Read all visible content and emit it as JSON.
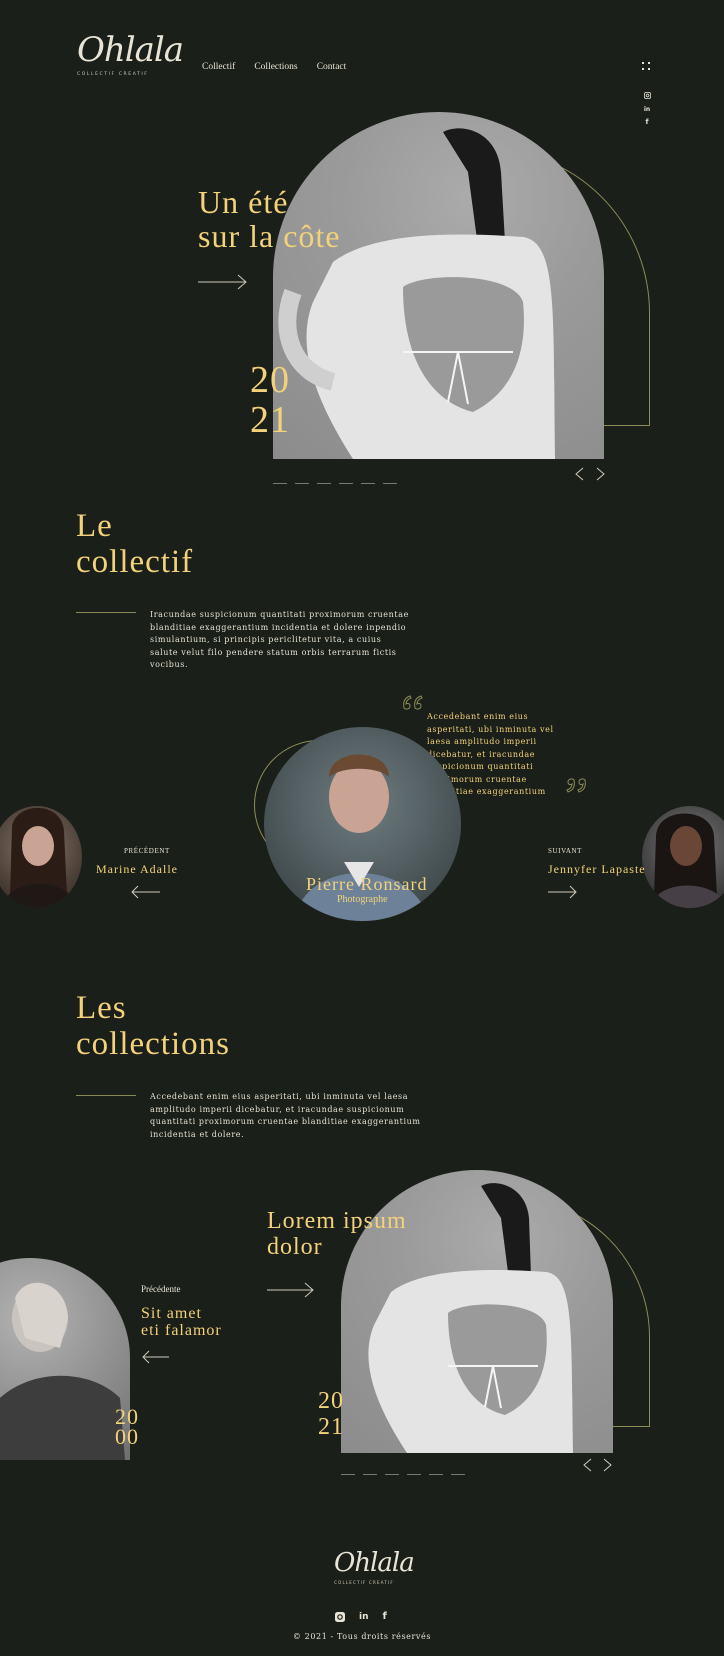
{
  "brand": {
    "logo": "Ohlala",
    "tagline": "COLLECTIF CREATIF"
  },
  "nav": {
    "items": [
      "Collectif",
      "Collections",
      "Contact"
    ]
  },
  "hero": {
    "title_line1": "Un été",
    "title_line2": "sur la côte",
    "year_top": "20",
    "year_bottom": "21"
  },
  "collectif": {
    "title_line1": "Le",
    "title_line2": "collectif",
    "text": "Iracundae suspicionum quantitati proximorum cruentae blanditiae exaggerantium incidentia et dolere inpendio simulantium, si principis periclitetur vita, a cuius salute velut filo pendere statum orbis terrarum fictis vocibus."
  },
  "member": {
    "quote": "Accedebant enim eius asperitati, ubi inminuta vel laesa amplitudo imperii dicebatur, et iracundae suspicionum quantitati proximorum cruentae blanditiae exaggerantium filo.",
    "name": "Pierre Ronsard",
    "role": "Photographe",
    "prev_label": "PRÉCÉDENT",
    "prev_name": "Marine Adalle",
    "next_label": "SUIVANT",
    "next_name": "Jennyfer Lapaste"
  },
  "collections": {
    "title_line1": "Les",
    "title_line2": "collections",
    "text": "Accedebant enim eius asperitati, ubi inminuta vel laesa amplitudo imperii dicebatur, et iracundae suspicionum quantitati proximorum cruentae blanditiae exaggerantium incidentia et dolere."
  },
  "collection_slider": {
    "title_line1": "Lorem ipsum",
    "title_line2": "dolor",
    "prev_label": "Précédente",
    "prev_title_line1": "Sit amet",
    "prev_title_line2": "eti falamor",
    "prev_year_top": "20",
    "prev_year_bottom": "00",
    "year_top": "20",
    "year_bottom": "21"
  },
  "footer": {
    "logo": "Ohlala",
    "tagline": "COLLECTIF CREATIF",
    "copyright": "© 2021 - Tous droits réservés"
  },
  "colors": {
    "background": "#1b1f19",
    "accent": "#f2d27a",
    "outline": "#8c8c55"
  }
}
